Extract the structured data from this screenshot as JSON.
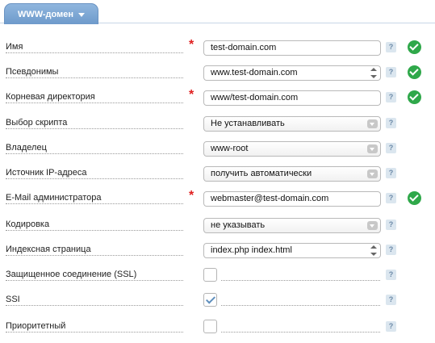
{
  "tab": {
    "label": "WWW-домен"
  },
  "fields": [
    {
      "label": "Имя",
      "value": "test-domain.com",
      "required": true,
      "kind": "text",
      "ok": true
    },
    {
      "label": "Псевдонимы",
      "value": "www.test-domain.com",
      "required": false,
      "kind": "spin",
      "ok": true
    },
    {
      "label": "Корневая директория",
      "value": "www/test-domain.com",
      "required": true,
      "kind": "text",
      "ok": true
    },
    {
      "label": "Выбор скрипта",
      "value": "Не устанавливать",
      "required": false,
      "kind": "select",
      "ok": false
    },
    {
      "label": "Владелец",
      "value": "www-root",
      "required": false,
      "kind": "select",
      "ok": false
    },
    {
      "label": "Источник IP-адреса",
      "value": "получить автоматически",
      "required": false,
      "kind": "select",
      "ok": false
    },
    {
      "label": "E-Mail администратора",
      "value": "webmaster@test-domain.com",
      "required": true,
      "kind": "text",
      "ok": true
    },
    {
      "label": "Кодировка",
      "value": "не указывать",
      "required": false,
      "kind": "select",
      "ok": false
    },
    {
      "label": "Индексная страница",
      "value": "index.php index.html",
      "required": false,
      "kind": "spin",
      "ok": false
    },
    {
      "label": "Защищенное соединение (SSL)",
      "checked": false,
      "kind": "checkbox"
    },
    {
      "label": "SSI",
      "checked": true,
      "kind": "checkbox"
    },
    {
      "label": "Приоритетный",
      "checked": false,
      "kind": "checkbox"
    }
  ],
  "help_glyph": "?",
  "icons": {
    "required": "required-asterisk-icon",
    "help": "help-icon",
    "ok": "check-circle-icon"
  },
  "colors": {
    "tab": "#7ba6d4",
    "required": "#e02020",
    "ok": "#2fa84a",
    "checkbox_check": "#5f8fbd"
  }
}
